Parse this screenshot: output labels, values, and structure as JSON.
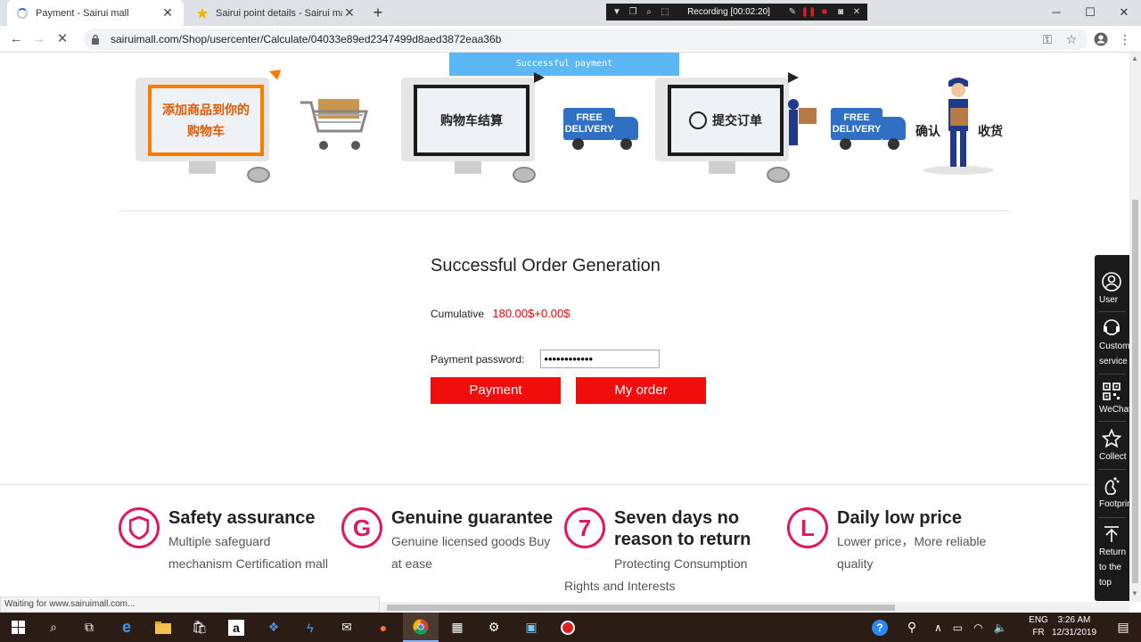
{
  "browser": {
    "tabs": [
      {
        "title": "Payment - Sairui mall",
        "active": true
      },
      {
        "title": "Sairui point details - Sairui mall",
        "active": false
      }
    ],
    "recorder": {
      "text": "Recording [00:02:20]"
    },
    "url": "sairuimall.com/Shop/usercenter/Calculate/04033e89ed2347499d8aed3872eaa36b",
    "status_text": "Waiting for www.sairuimall.com..."
  },
  "page": {
    "toast": "Successful payment",
    "steps": [
      {
        "label": "添加商品到你的购物车",
        "line1": "添加商品到你的",
        "line2": "购物车"
      },
      {
        "label": "购物车结算"
      },
      {
        "label": "提交订单"
      },
      {
        "label_a": "确认",
        "label_b": "收货"
      }
    ],
    "truck_text": "FREE\nDELIVERY",
    "order": {
      "title": "Successful Order Generation",
      "cumulative_label": "Cumulative",
      "cumulative_value": "180.00$+0.00$",
      "password_label": "Payment password:",
      "password_value": "••••••••••••",
      "payment_button": "Payment",
      "my_order_button": "My order"
    },
    "features": [
      {
        "badge": "◈",
        "title": "Safety assurance",
        "desc1": "Multiple safeguard",
        "desc2": "mechanism Certification mall"
      },
      {
        "badge": "G",
        "title": "Genuine guarantee",
        "desc1": "Genuine licensed goods Buy",
        "desc2": "at ease"
      },
      {
        "badge": "7",
        "title1": "Seven days no",
        "title2": "reason to return",
        "desc1": "Protecting Consumption",
        "desc2": "Rights and Interests"
      },
      {
        "badge": "L",
        "title": "Daily low price",
        "desc1": "Lower price，More reliable",
        "desc2": "quality"
      }
    ],
    "sidebar": [
      {
        "icon": "user-icon",
        "label": "User"
      },
      {
        "icon": "headset-icon",
        "label1": "Custom",
        "label2": "service"
      },
      {
        "icon": "qr-code-icon",
        "label": "WeChat"
      },
      {
        "icon": "star-icon",
        "label": "Collect"
      },
      {
        "icon": "footprint-icon",
        "label": "Footprint"
      },
      {
        "icon": "arrow-up-icon",
        "label1": "Return",
        "label2": "to the",
        "label3": "top"
      }
    ]
  },
  "taskbar": {
    "lang1": "ENG",
    "lang2": "FR",
    "time": "3:26 AM",
    "date": "12/31/2019"
  }
}
